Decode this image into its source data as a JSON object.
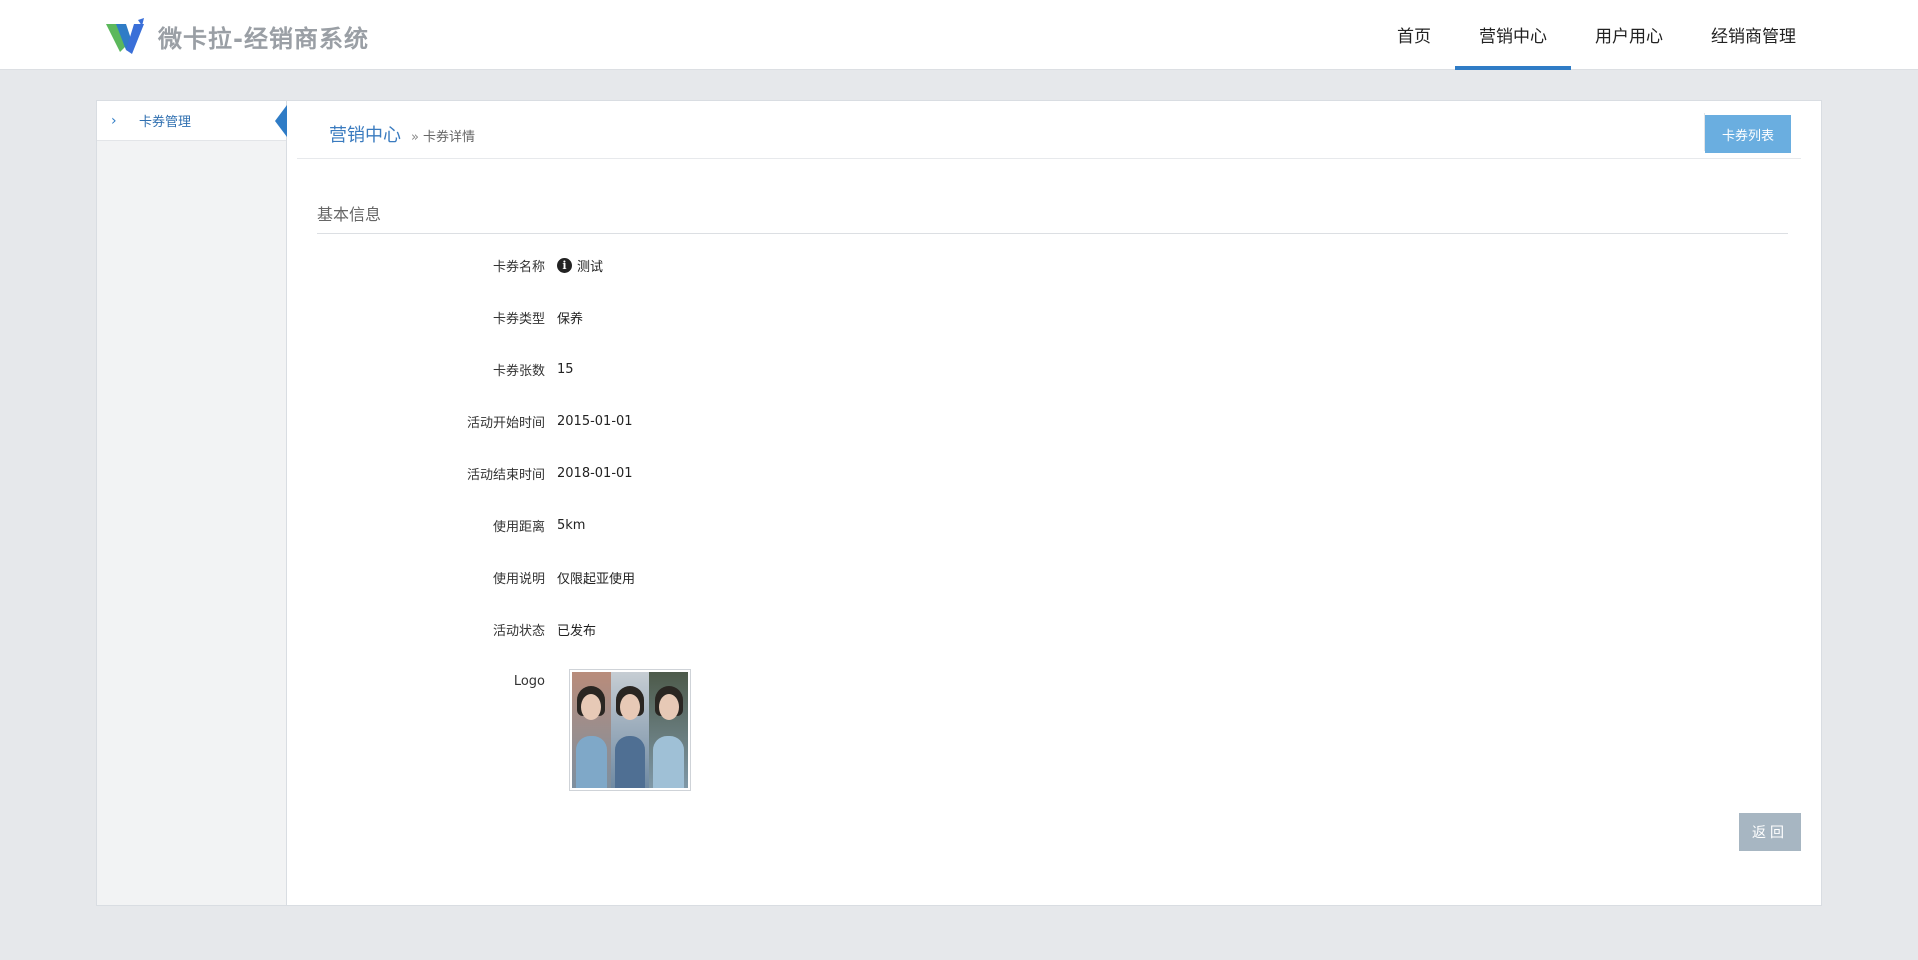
{
  "header": {
    "title": "微卡拉-经销商系统",
    "nav": [
      {
        "label": "首页",
        "active": false
      },
      {
        "label": "营销中心",
        "active": true
      },
      {
        "label": "用户用心",
        "active": false
      },
      {
        "label": "经销商管理",
        "active": false
      }
    ]
  },
  "sidebar": {
    "items": [
      {
        "label": "卡券管理",
        "active": true
      }
    ]
  },
  "breadcrumb": {
    "root": "营销中心",
    "separator": "»",
    "current": "卡券详情"
  },
  "toolbar": {
    "list_label": "卡券列表"
  },
  "section": {
    "title": "基本信息"
  },
  "fields": [
    {
      "label": "卡券名称",
      "value": "测试",
      "icon": "info-icon"
    },
    {
      "label": "卡券类型",
      "value": "保养"
    },
    {
      "label": "卡券张数",
      "value": "15"
    },
    {
      "label": "活动开始时间",
      "value": "2015-01-01"
    },
    {
      "label": "活动结束时间",
      "value": "2018-01-01"
    },
    {
      "label": "使用距离",
      "value": "5km"
    },
    {
      "label": "使用说明",
      "value": "仅限起亚使用"
    },
    {
      "label": "活动状态",
      "value": "已发布"
    },
    {
      "label": "Logo",
      "value": ""
    }
  ],
  "actions": {
    "back_label": "返回"
  },
  "colors": {
    "accent": "#2f7cc6",
    "list_button": "#6aaee0",
    "back_button": "#a7b6c2"
  }
}
